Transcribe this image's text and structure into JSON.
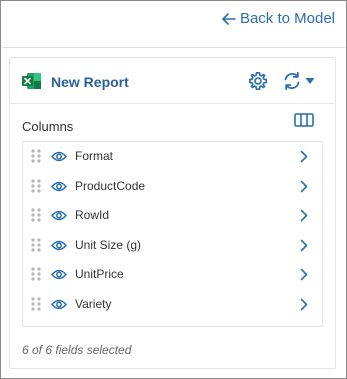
{
  "topbar": {
    "back_label": "Back to Model"
  },
  "report": {
    "title": "New Report"
  },
  "columns": {
    "label": "Columns",
    "items": [
      {
        "label": "Format"
      },
      {
        "label": "ProductCode"
      },
      {
        "label": "RowId"
      },
      {
        "label": "Unit Size (g)"
      },
      {
        "label": "UnitPrice"
      },
      {
        "label": "Variety"
      }
    ]
  },
  "footer": {
    "selected_text": "6 of 6 fields selected"
  },
  "colors": {
    "accent": "#2a6fb0",
    "excel_green": "#1e7a44",
    "icon_gray": "#8c8c8c"
  },
  "icons": [
    "arrow-left-icon",
    "excel-icon",
    "gear-icon",
    "refresh-icon",
    "caret-down-icon",
    "columns-icon",
    "drag-handle-icon",
    "eye-icon",
    "chevron-right-icon"
  ]
}
